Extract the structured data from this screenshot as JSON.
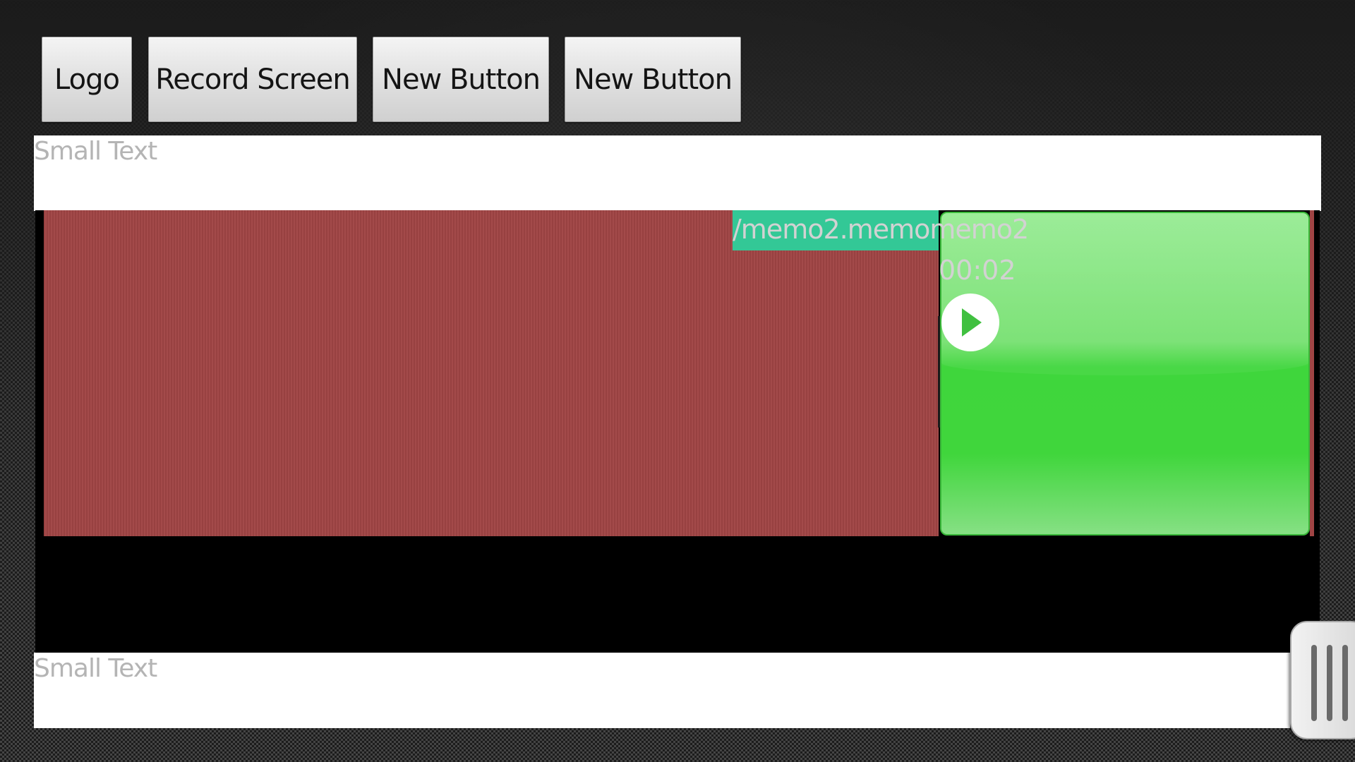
{
  "toolbar": {
    "logo_label": "Logo",
    "record_label": "Record Screen",
    "new_button_1_label": "New Button",
    "new_button_2_label": "New Button"
  },
  "top_panel": {
    "text": "Small Text"
  },
  "media": {
    "filename": "/memo2.memomemo2",
    "duration": "00:02",
    "colors": {
      "canvas": "#a04444",
      "filename_bg": "#33c896",
      "player": "#40d63c"
    },
    "icons": {
      "play": "play-icon"
    }
  },
  "bottom_panel": {
    "text": "Small Text"
  },
  "drawer": {
    "icon": "grip-icon"
  }
}
